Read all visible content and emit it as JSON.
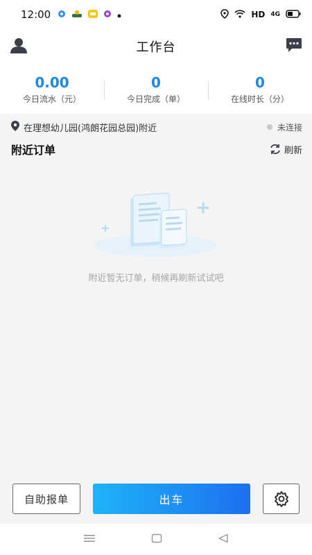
{
  "status_bar": {
    "time": "12:00",
    "network": "HD",
    "signal": "4G"
  },
  "header": {
    "title": "工作台"
  },
  "stats": [
    {
      "value": "0.00",
      "label": "今日流水（元）"
    },
    {
      "value": "0",
      "label": "今日完成（单）"
    },
    {
      "value": "0",
      "label": "在线时长（分）"
    }
  ],
  "location": {
    "text": "在理想幼儿园(鸿朗花园总园)附近",
    "connection_status": "未连接"
  },
  "orders": {
    "title": "附近订单",
    "refresh_label": "刷新",
    "empty_message": "附近暂无订单，稍候再刷新试试吧"
  },
  "actions": {
    "self_report_label": "自助报单",
    "depart_label": "出车"
  },
  "colors": {
    "accent": "#1e88e5",
    "button_gradient_start": "#1fb4f8",
    "button_gradient_end": "#1d6ff0"
  }
}
